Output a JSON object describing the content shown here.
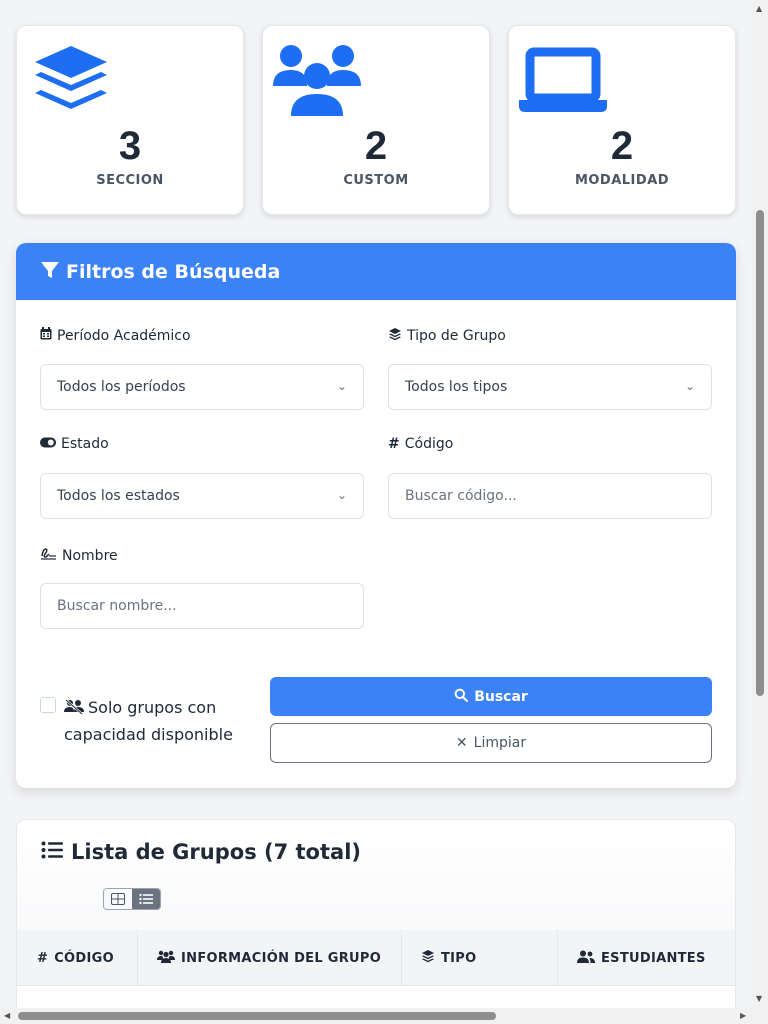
{
  "stats": [
    {
      "value": "3",
      "label": "SECCION",
      "icon": "layers-icon"
    },
    {
      "value": "2",
      "label": "CUSTOM",
      "icon": "users-icon"
    },
    {
      "value": "2",
      "label": "MODALIDAD",
      "icon": "laptop-icon"
    }
  ],
  "colors": {
    "primary": "#3b82f6",
    "icon_blue": "#1d6ef2",
    "text_dark": "#1f2937"
  },
  "filters": {
    "title": "Filtros de Búsqueda",
    "periodo": {
      "label": "Período Académico",
      "value": "Todos los períodos"
    },
    "tipo": {
      "label": "Tipo de Grupo",
      "value": "Todos los tipos"
    },
    "estado": {
      "label": "Estado",
      "value": "Todos los estados"
    },
    "codigo": {
      "label": "Código",
      "placeholder": "Buscar código..."
    },
    "nombre": {
      "label": "Nombre",
      "placeholder": "Buscar nombre..."
    },
    "capacidad_label": "Solo grupos con capacidad disponible",
    "buscar_label": "Buscar",
    "limpiar_label": "Limpiar"
  },
  "list": {
    "title": "Lista de Grupos (7 total)",
    "columns": [
      "CÓDIGO",
      "INFORMACIÓN DEL GRUPO",
      "TIPO",
      "ESTUDIANTES"
    ]
  }
}
